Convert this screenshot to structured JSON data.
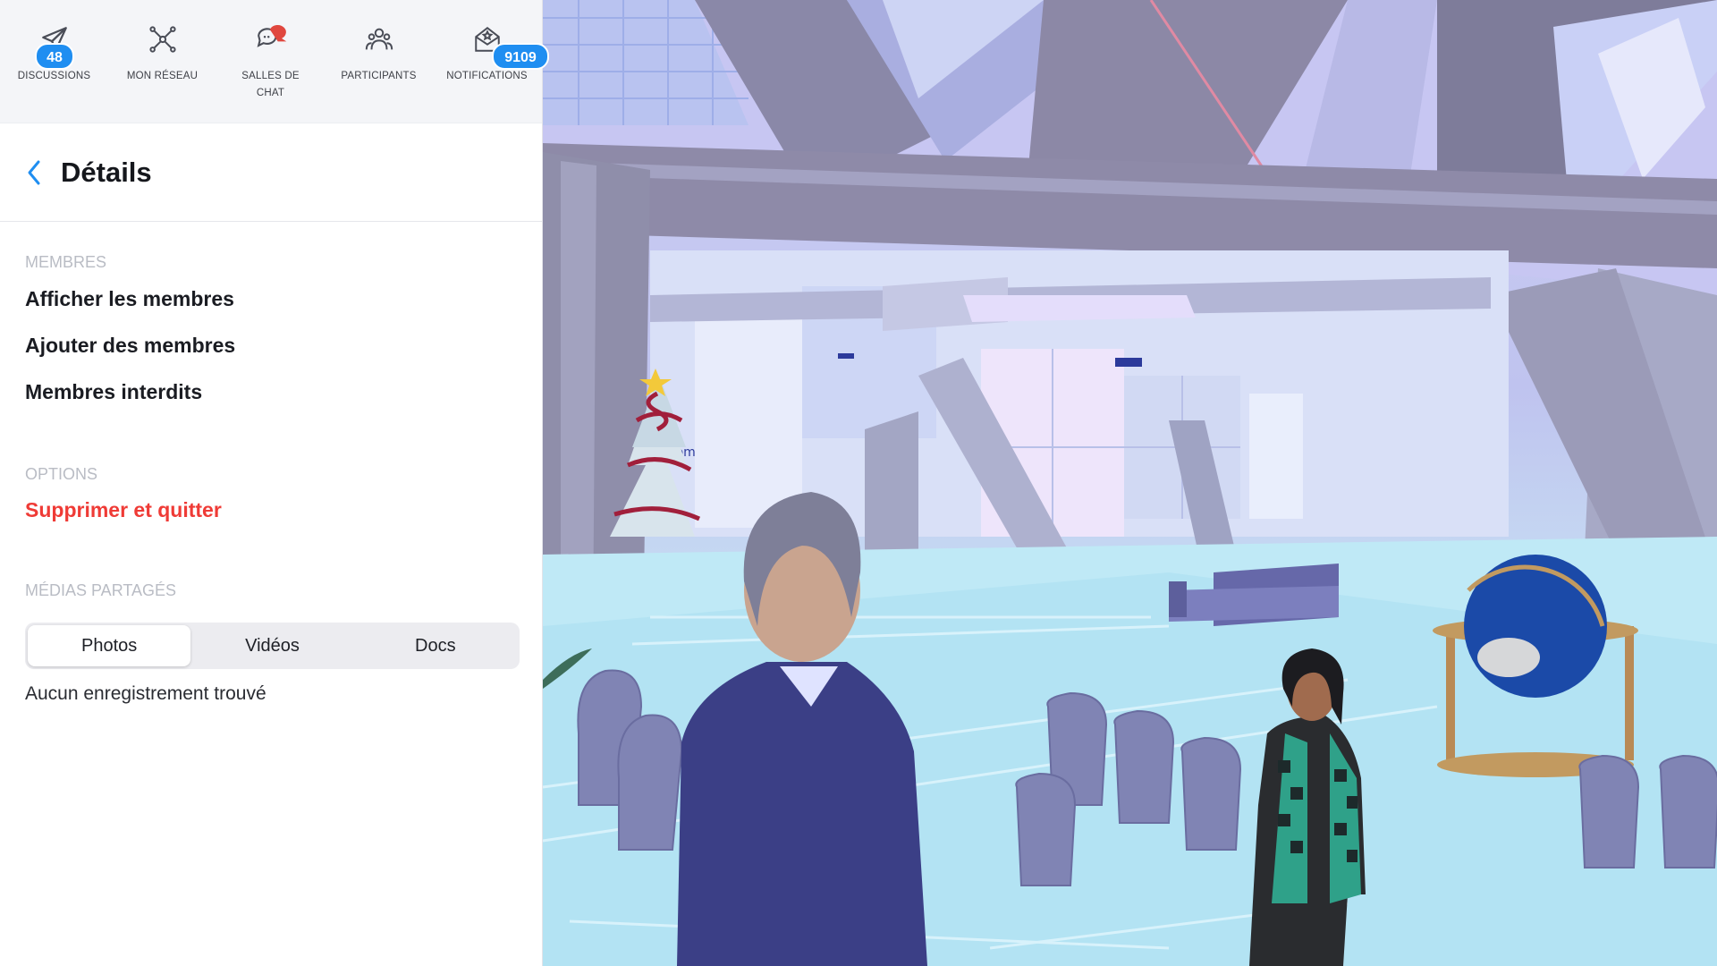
{
  "nav": {
    "items": [
      {
        "label": "DISCUSSIONS",
        "icon": "paper-plane-icon",
        "badge": "48"
      },
      {
        "label": "MON RÉSEAU",
        "icon": "network-icon",
        "badge": ""
      },
      {
        "label": "SALLES DE CHAT",
        "icon": "chat-bubbles-icon",
        "badge": ""
      },
      {
        "label": "PARTICIPANTS",
        "icon": "participants-icon",
        "badge": ""
      },
      {
        "label": "NOTIFICATIONS",
        "icon": "notification-envelope-icon",
        "badge": "9109"
      }
    ]
  },
  "header": {
    "title": "Détails"
  },
  "members": {
    "heading": "MEMBRES",
    "view": "Afficher les membres",
    "add": "Ajouter des membres",
    "banned": "Membres interdits"
  },
  "options": {
    "heading": "OPTIONS",
    "delete_quit": "Supprimer et quitter"
  },
  "media": {
    "heading": "MÉDIAS PARTAGÉS",
    "tabs": [
      "Photos",
      "Vidéos",
      "Docs"
    ],
    "active_tab": "Photos",
    "empty_text": "Aucun enregistrement trouvé"
  },
  "colors": {
    "accent": "#1f8ef1",
    "danger": "#ef3b36",
    "muted": "#b9bcc4"
  }
}
